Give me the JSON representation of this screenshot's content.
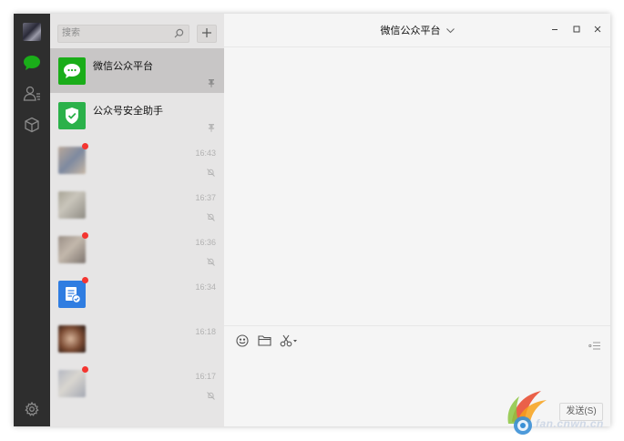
{
  "app": {
    "accent_color": "#1aad19"
  },
  "rail": {
    "items": [
      {
        "icon": "chat-icon",
        "active": true
      },
      {
        "icon": "contacts-icon",
        "active": false
      },
      {
        "icon": "favorites-box-icon",
        "active": false
      }
    ],
    "bottom_icon": "gear-icon"
  },
  "search": {
    "placeholder": "搜索"
  },
  "chat_list": [
    {
      "name": "微信公众平台",
      "time": "",
      "indicator": "pin-icon",
      "selected": true,
      "unread": false
    },
    {
      "name": "公众号安全助手",
      "time": "",
      "indicator": "pin-icon",
      "selected": false,
      "unread": false
    },
    {
      "name": "",
      "time": "16:43",
      "indicator": "mute-icon",
      "selected": false,
      "unread": true
    },
    {
      "name": "",
      "time": "16:37",
      "indicator": "mute-icon",
      "selected": false,
      "unread": false
    },
    {
      "name": "",
      "time": "16:36",
      "indicator": "mute-icon",
      "selected": false,
      "unread": true
    },
    {
      "name": "",
      "time": "16:34",
      "indicator": "",
      "selected": false,
      "unread": true
    },
    {
      "name": "",
      "time": "16:18",
      "indicator": "",
      "selected": false,
      "unread": false
    },
    {
      "name": "",
      "time": "16:17",
      "indicator": "mute-icon",
      "selected": false,
      "unread": true
    }
  ],
  "chat_panel": {
    "title": "微信公众平台",
    "window_controls": [
      "minimize-icon",
      "maximize-icon",
      "close-icon"
    ],
    "toolbar": [
      "emoji-icon",
      "folder-icon",
      "scissors-icon"
    ],
    "send_label": "发送(S)"
  },
  "watermark": {
    "text": "fan.cnwn.cn"
  }
}
